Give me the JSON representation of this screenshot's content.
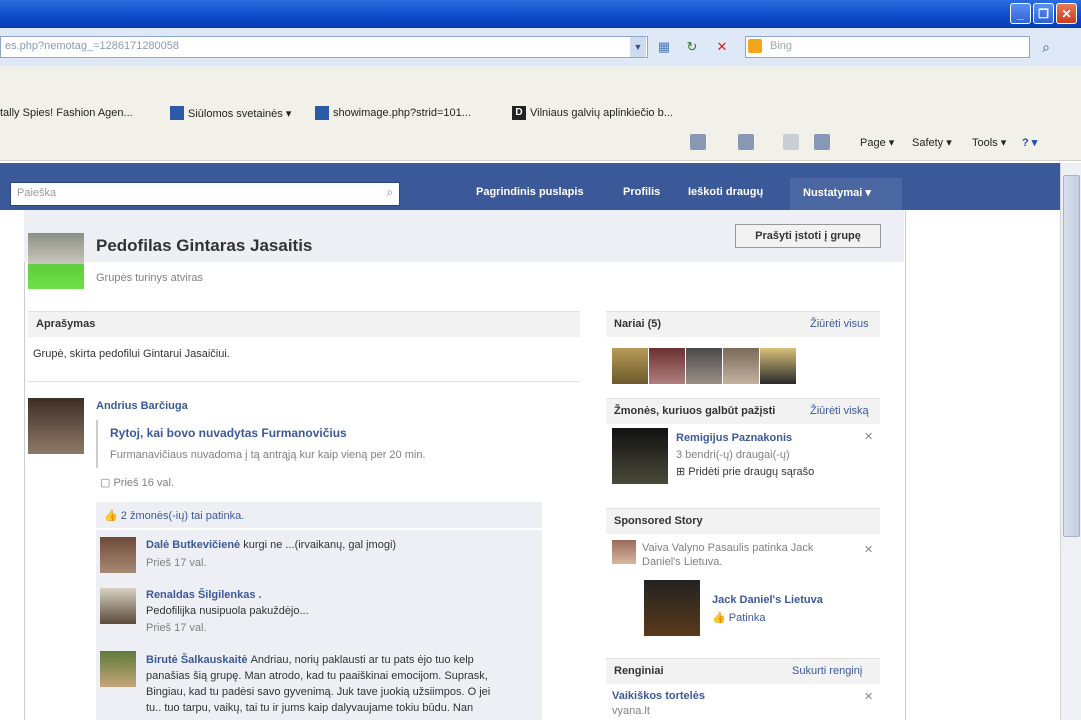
{
  "browser": {
    "address": "es.php?nemotag_=1286171280058",
    "search_placeholder": "Bing",
    "window_buttons": [
      "minimize",
      "restore",
      "close"
    ],
    "favorites": [
      {
        "label": "tally Spies! Fashion Agen..."
      },
      {
        "label": "Siūlomos svetainės ▾"
      },
      {
        "label": "showimage.php?strid=101..."
      },
      {
        "label": "Vilniaus galvių aplinkiečio b..."
      }
    ],
    "commands": {
      "page": "Page ▾",
      "safety": "Safety ▾",
      "tools": "Tools ▾",
      "help": "? ▾"
    }
  },
  "facebook": {
    "search_placeholder": "Paieška",
    "nav": {
      "home": "Pagrindinis puslapis",
      "profile": "Profilis",
      "find_friends": "Ieškoti draugų",
      "settings": "Nustatymai ▾"
    },
    "group": {
      "title": "Pedofilas Gintaras Jasaitis",
      "subtitle": "Grupės turinys atviras",
      "join_button": "Prašyti įstoti į grupę"
    },
    "about": {
      "heading": "Aprašymas",
      "text": "Grupė, skirta pedofilui Gintarui Jasaičiui."
    },
    "post": {
      "author": "Andrius Barčiuga",
      "attachment_title": "Rytoj, kai bovo nuvadytas Furmanovičius",
      "attachment_desc": "Furmanavičiaus nuvadoma į tą antrąją kur kaip vieną per 20 min.",
      "time": "Prieš 16 val.",
      "likes": "2 žmonės(-ių) tai patinka."
    },
    "comments": [
      {
        "name": "Dalė Butkevičienė",
        "text": "kurgi ne ...(irvaikanų, gal įmogi)",
        "time": "Prieš 17 val."
      },
      {
        "name": "Renaldas Šilgilenkas .",
        "text": "Pedofilijka nusipuola pakuždėjo...",
        "time": "Prieš 17 val."
      },
      {
        "name": "Birutė Šalkauskaitė",
        "text": "Andriau, norių paklausti ar tu pats ėjo tuo kelp",
        "text2": "panašias šią grupę. Man atrodo, kad tu paaiškinai emocijom. Suprask,",
        "text3": "Bingiau, kad tu padėsi savo gyvenimą. Juk tave juokią užsiimpos. O jei",
        "text4": "tu.. tuo tarpu, vaikų, tai tu ir jums kaip dalyvaujame tokiu būdu. Nan"
      }
    ],
    "sidebar": {
      "members_heading": "Nariai (5)",
      "members_link": "Žiūrėti visus",
      "pymk_heading": "Žmonės, kuriuos galbūt pažįsti",
      "pymk_link": "Žiūrėti viską",
      "pymk_name": "Remigijus Paznakonis",
      "pymk_mutual": "3 bendri(-ų) draugai(-ų)",
      "pymk_add": "Pridėti prie draugų sąrašo",
      "sponsored_heading": "Sponsored Story",
      "sponsored_text": "Vaiva Valyno Pasaulis patinka Jack",
      "sponsored_text2": "Daniel's Lietuva.",
      "sponsored_page": "Jack Daniel's Lietuva",
      "sponsored_like": "Patinka",
      "events_heading": "Renginiai",
      "events_link": "Sukurti renginį",
      "event_name": "Vaikiškos tortelės",
      "event_sub": "vyana.lt"
    }
  }
}
